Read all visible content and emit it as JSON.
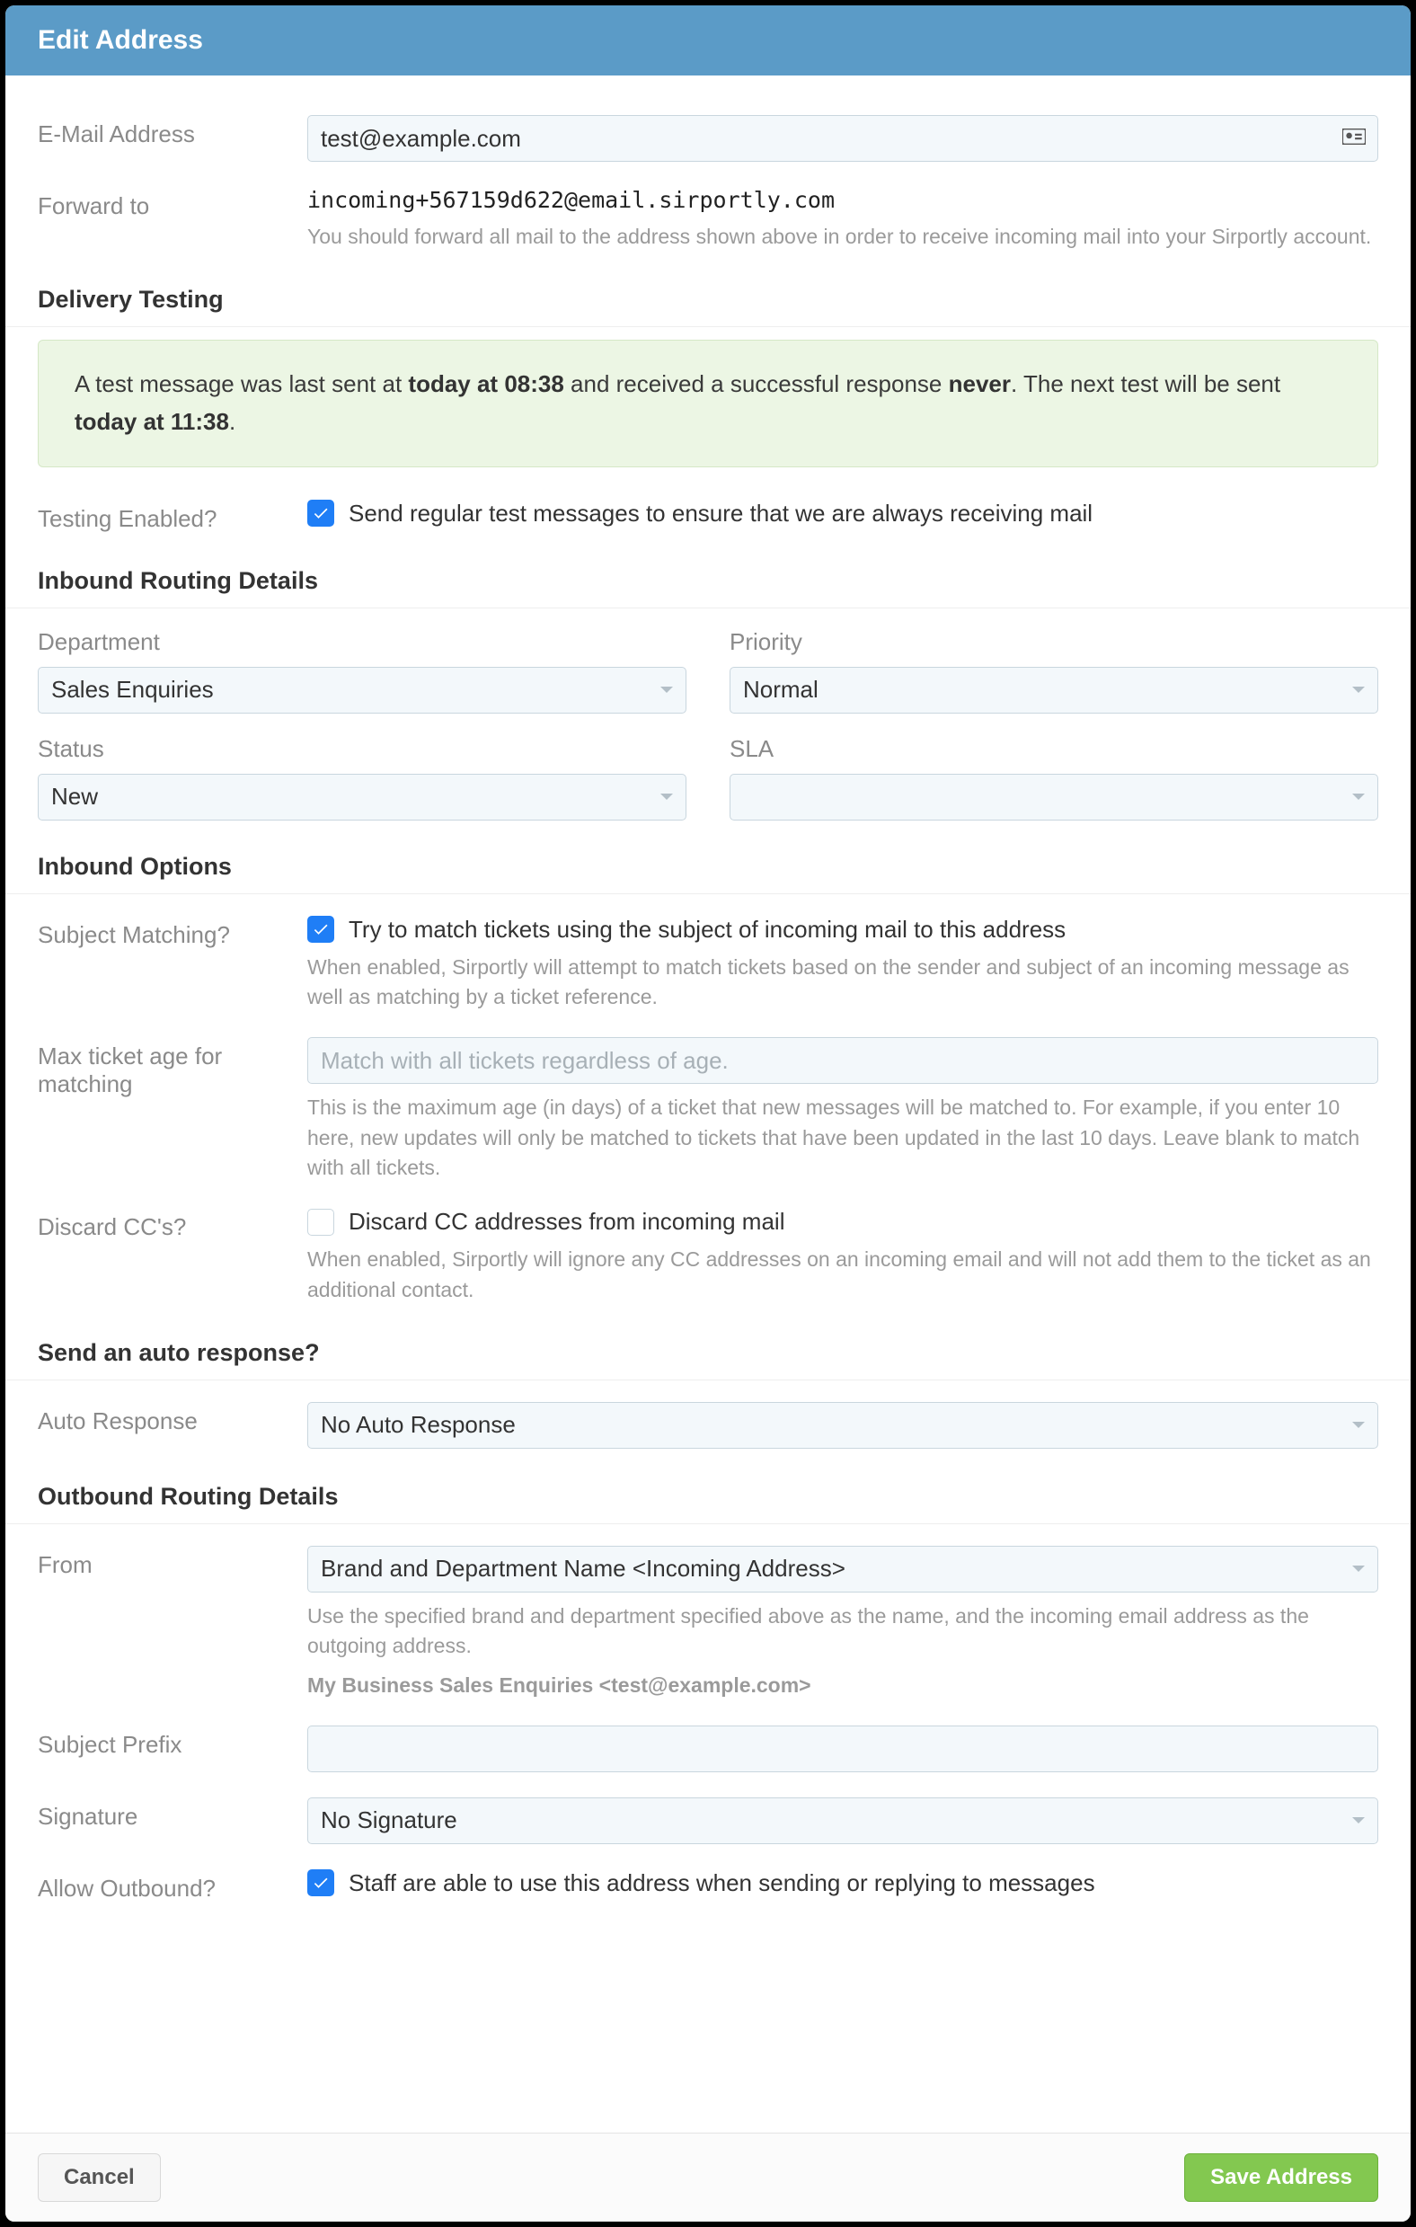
{
  "modal": {
    "title": "Edit Address"
  },
  "email": {
    "label": "E-Mail Address",
    "value": "test@example.com"
  },
  "forward": {
    "label": "Forward to",
    "address": "incoming+567159d622@email.sirportly.com",
    "help": "You should forward all mail to the address shown above in order to receive incoming mail into your Sirportly account."
  },
  "delivery": {
    "section_title": "Delivery Testing",
    "info_prefix": "A test message was last sent at ",
    "info_last_sent": "today at 08:38",
    "info_mid": " and received a successful response ",
    "info_response": "never",
    "info_next_prefix": ". The next test will be sent ",
    "info_next": "today at 11:38",
    "info_suffix": ".",
    "testing_label": "Testing Enabled?",
    "testing_checkbox": "Send regular test messages to ensure that we are always receiving mail",
    "testing_checked": true
  },
  "inbound_routing": {
    "section_title": "Inbound Routing Details",
    "department_label": "Department",
    "department_value": "Sales Enquiries",
    "priority_label": "Priority",
    "priority_value": "Normal",
    "status_label": "Status",
    "status_value": "New",
    "sla_label": "SLA",
    "sla_value": ""
  },
  "inbound_options": {
    "section_title": "Inbound Options",
    "subject_label": "Subject Matching?",
    "subject_checkbox": "Try to match tickets using the subject of incoming mail to this address",
    "subject_checked": true,
    "subject_help": "When enabled, Sirportly will attempt to match tickets based on the sender and subject of an incoming message as well as matching by a ticket reference.",
    "maxage_label": "Max ticket age for matching",
    "maxage_value": "",
    "maxage_placeholder": "Match with all tickets regardless of age.",
    "maxage_help": "This is the maximum age (in days) of a ticket that new messages will be matched to. For example, if you enter 10 here, new updates will only be matched to tickets that have been updated in the last 10 days. Leave blank to match with all tickets.",
    "discard_label": "Discard CC's?",
    "discard_checkbox": "Discard CC addresses from incoming mail",
    "discard_checked": false,
    "discard_help": "When enabled, Sirportly will ignore any CC addresses on an incoming email and will not add them to the ticket as an additional contact."
  },
  "auto_response": {
    "section_title": "Send an auto response?",
    "label": "Auto Response",
    "value": "No Auto Response"
  },
  "outbound": {
    "section_title": "Outbound Routing Details",
    "from_label": "From",
    "from_value": "Brand and Department Name <Incoming Address>",
    "from_help": "Use the specified brand and department specified above as the name, and the incoming email address as the outgoing address.",
    "from_example": "My Business Sales Enquiries <test@example.com>",
    "prefix_label": "Subject Prefix",
    "prefix_value": "",
    "signature_label": "Signature",
    "signature_value": "No Signature",
    "allow_label": "Allow Outbound?",
    "allow_checkbox": "Staff are able to use this address when sending or replying to messages",
    "allow_checked": true
  },
  "footer": {
    "cancel": "Cancel",
    "save": "Save Address"
  }
}
